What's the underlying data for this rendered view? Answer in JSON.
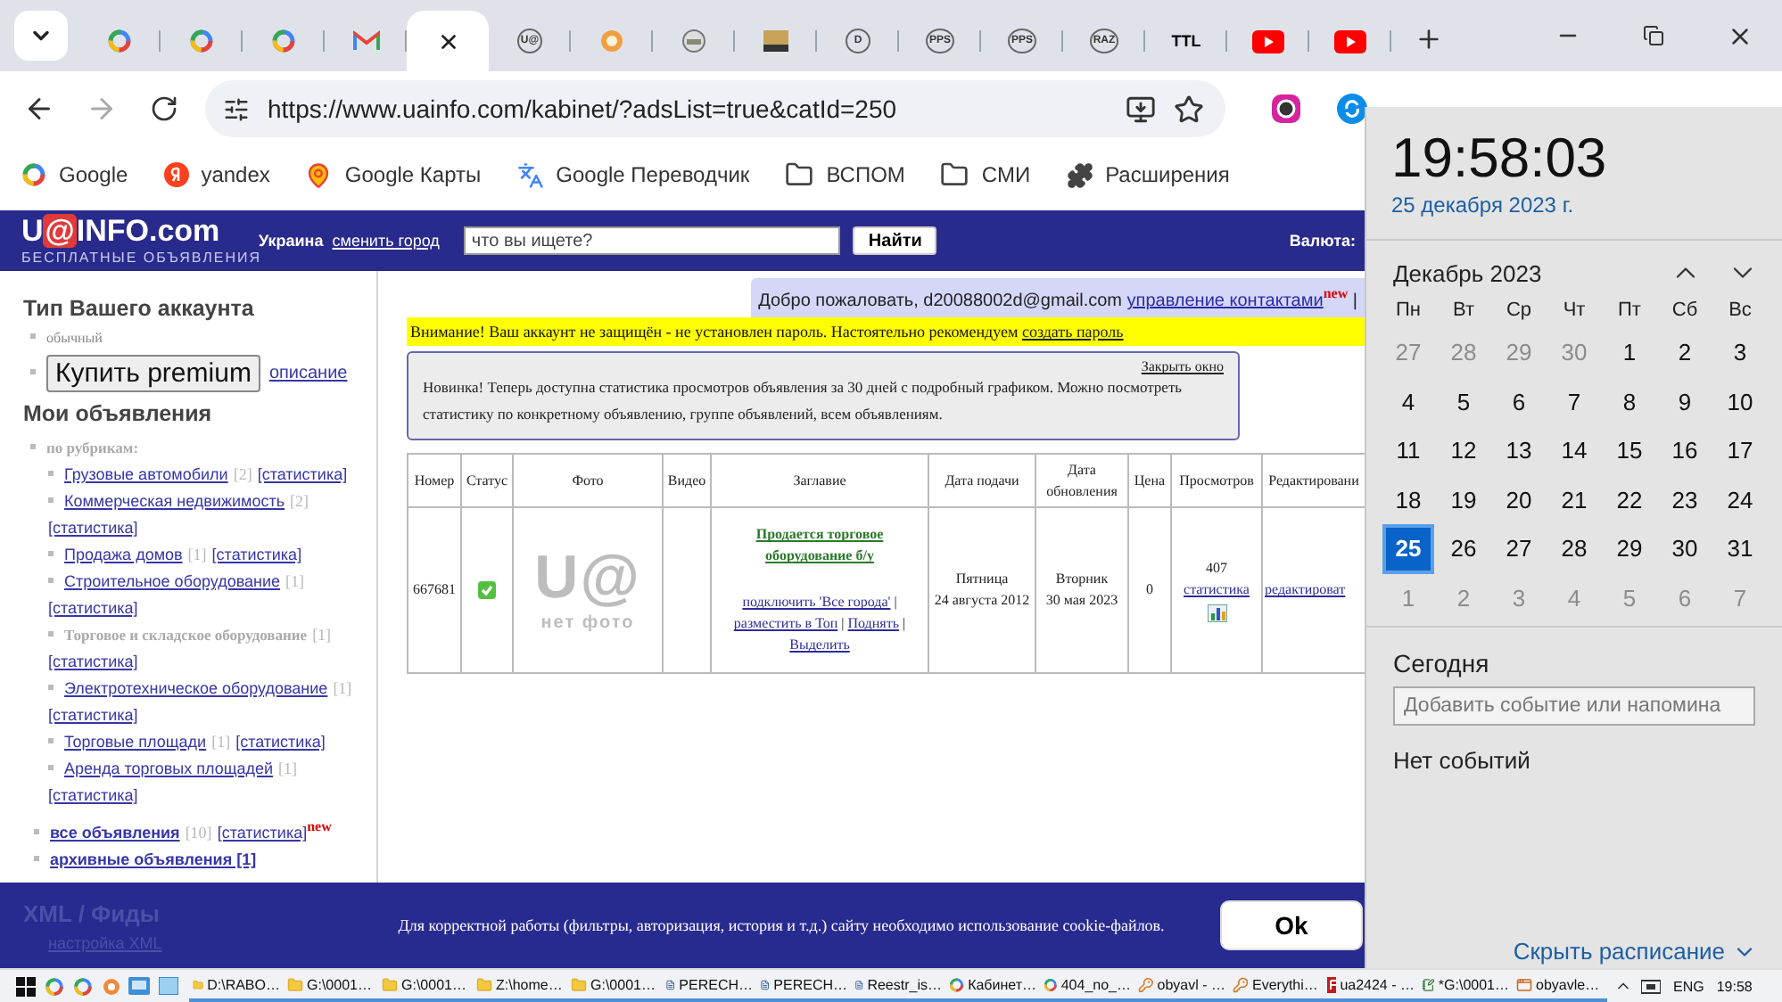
{
  "browser": {
    "tabs": [
      {
        "kind": "ring",
        "selected": false
      },
      {
        "kind": "ring",
        "selected": false
      },
      {
        "kind": "ring",
        "selected": false
      },
      {
        "kind": "mail",
        "selected": false
      },
      {
        "kind": "blank",
        "selected": true
      },
      {
        "kind": "text",
        "label": "U@",
        "selected": false
      },
      {
        "kind": "dot",
        "selected": false
      },
      {
        "kind": "roundphoto",
        "selected": false
      },
      {
        "kind": "photo",
        "selected": false
      },
      {
        "kind": "text",
        "label": "D",
        "selected": false
      },
      {
        "kind": "text",
        "label": "PPS",
        "selected": false
      },
      {
        "kind": "text",
        "label": "PPS",
        "selected": false
      },
      {
        "kind": "text",
        "label": "RAZ",
        "selected": false
      },
      {
        "kind": "boldtext",
        "label": "TTL",
        "selected": false
      },
      {
        "kind": "play",
        "selected": false
      },
      {
        "kind": "play",
        "selected": false
      }
    ],
    "url": "https://www.uainfo.com/kabinet/?adsList=true&catId=250",
    "bookmarks": [
      {
        "label": "Google",
        "kind": "ring"
      },
      {
        "label": "yandex",
        "kind": "dot"
      },
      {
        "label": "Google Карты",
        "kind": "pin"
      },
      {
        "label": "Google Переводчик",
        "kind": "translate"
      },
      {
        "label": "ВСПОМ",
        "kind": "folder"
      },
      {
        "label": "СМИ",
        "kind": "folder"
      },
      {
        "label": "Расширения",
        "kind": "puzzle"
      }
    ]
  },
  "site_header": {
    "logo": {
      "before": "U",
      "mark": "@",
      "after": "INFO.com"
    },
    "tagline": "БЕСПЛАТНЫЕ ОБЪЯВЛЕНИЯ",
    "region": "Украина",
    "change_city": "сменить город",
    "search": {
      "placeholder": "что вы ищете?"
    },
    "search_button": "Найти",
    "currency_label": "Валюта:"
  },
  "sidebar": {
    "account_heading": "Тип Вашего аккаунта",
    "account_type": "обычный",
    "premium_button": "Купить premium",
    "premium_link": "описание",
    "ads_heading": "Мои объявления",
    "by_category": "по рубрикам:",
    "categories": [
      {
        "name": "Грузовые автомобили",
        "linked": true,
        "count": "[2]",
        "stats": "[статистика]"
      },
      {
        "name": "Коммерческая недвижимость",
        "linked": true,
        "count": "[2]",
        "stats": "[статистика]"
      },
      {
        "name": "Продажа домов",
        "linked": true,
        "count": "[1]",
        "stats": "[статистика]"
      },
      {
        "name": "Строительное оборудование",
        "linked": true,
        "count": "[1]",
        "stats": "[статистика]"
      },
      {
        "name": "Торговое и складское оборудование",
        "linked": false,
        "count": "[1]",
        "stats": "[статистика]"
      },
      {
        "name": "Электротехническое оборудование",
        "linked": true,
        "count": "[1]",
        "stats": "[статистика]"
      },
      {
        "name": "Торговые площади",
        "linked": true,
        "count": "[1]",
        "stats": "[статистика]"
      },
      {
        "name": "Аренда торговых площадей",
        "linked": true,
        "count": "[1]",
        "stats": "[статистика]"
      }
    ],
    "all_ads": {
      "label": "все объявления",
      "count": "[10]",
      "stats": "[статистика]",
      "badge": "new"
    },
    "archive": "архивные объявления [1]",
    "xml_heading": "XML / Фиды",
    "xml_setting": "настройка XML"
  },
  "main": {
    "welcome": {
      "text": "Добро пожаловать, d20088002d@gmail.com",
      "link": "управление контактами",
      "badge": "new",
      "separator": "|"
    },
    "warning": {
      "text": "Внимание! Ваш аккаунт не защищён - не установлен пароль. Настоятельно рекомендуем",
      "link": "создать пароль"
    },
    "notice": {
      "close": "Закрыть окно",
      "text": "Новинка! Теперь доступна статистика просмотров объявления за 30 дней с подробный графиком. Можно посмотреть статистику по конкретному объявлению, группе объявлений, всем объявлениям."
    },
    "table": {
      "columns": [
        "Номер",
        "Статус",
        "Фото",
        "Видео",
        "Заглавие",
        "Дата подачи",
        "Дата обновления",
        "Цена",
        "Просмотров",
        "Редактировани"
      ],
      "rows": [
        {
          "number": "667681",
          "status_ok": true,
          "photo_logo": "U@",
          "photo_caption": "нет фото",
          "title": "Продается торговое оборудование б/у",
          "actions": [
            "подключить 'Все города'",
            "разместить в Топ",
            "Поднять",
            "Выделить"
          ],
          "action_separator": "|",
          "posted_day": "Пятница",
          "posted_date": "24 августа 2012",
          "updated_day": "Вторник",
          "updated_date": "30 мая 2023",
          "price": "0",
          "views": "407",
          "stats": "статистика",
          "edit": "редактироват"
        }
      ]
    },
    "cookie": {
      "text": "Для корректной работы (фильтры, авторизация, история и т.д.) сайту необходимо использование cookie-файлов.",
      "button": "Ok"
    }
  },
  "clock_panel": {
    "time": "19:58:03",
    "date": "25 декабря 2023 г.",
    "month": "Декабрь 2023",
    "weekdays": [
      "Пн",
      "Вт",
      "Ср",
      "Чт",
      "Пт",
      "Сб",
      "Вс"
    ],
    "days": [
      {
        "label": "27",
        "in_month": false,
        "selected": false
      },
      {
        "label": "28",
        "in_month": false,
        "selected": false
      },
      {
        "label": "29",
        "in_month": false,
        "selected": false
      },
      {
        "label": "30",
        "in_month": false,
        "selected": false
      },
      {
        "label": "1",
        "in_month": true,
        "selected": false
      },
      {
        "label": "2",
        "in_month": true,
        "selected": false
      },
      {
        "label": "3",
        "in_month": true,
        "selected": false
      },
      {
        "label": "4",
        "in_month": true,
        "selected": false
      },
      {
        "label": "5",
        "in_month": true,
        "selected": false
      },
      {
        "label": "6",
        "in_month": true,
        "selected": false
      },
      {
        "label": "7",
        "in_month": true,
        "selected": false
      },
      {
        "label": "8",
        "in_month": true,
        "selected": false
      },
      {
        "label": "9",
        "in_month": true,
        "selected": false
      },
      {
        "label": "10",
        "in_month": true,
        "selected": false
      },
      {
        "label": "11",
        "in_month": true,
        "selected": false
      },
      {
        "label": "12",
        "in_month": true,
        "selected": false
      },
      {
        "label": "13",
        "in_month": true,
        "selected": false
      },
      {
        "label": "14",
        "in_month": true,
        "selected": false
      },
      {
        "label": "15",
        "in_month": true,
        "selected": false
      },
      {
        "label": "16",
        "in_month": true,
        "selected": false
      },
      {
        "label": "17",
        "in_month": true,
        "selected": false
      },
      {
        "label": "18",
        "in_month": true,
        "selected": false
      },
      {
        "label": "19",
        "in_month": true,
        "selected": false
      },
      {
        "label": "20",
        "in_month": true,
        "selected": false
      },
      {
        "label": "21",
        "in_month": true,
        "selected": false
      },
      {
        "label": "22",
        "in_month": true,
        "selected": false
      },
      {
        "label": "23",
        "in_month": true,
        "selected": false
      },
      {
        "label": "24",
        "in_month": true,
        "selected": false
      },
      {
        "label": "25",
        "in_month": true,
        "selected": true
      },
      {
        "label": "26",
        "in_month": true,
        "selected": false
      },
      {
        "label": "27",
        "in_month": true,
        "selected": false
      },
      {
        "label": "28",
        "in_month": true,
        "selected": false
      },
      {
        "label": "29",
        "in_month": true,
        "selected": false
      },
      {
        "label": "30",
        "in_month": true,
        "selected": false
      },
      {
        "label": "31",
        "in_month": true,
        "selected": false
      },
      {
        "label": "1",
        "in_month": false,
        "selected": false
      },
      {
        "label": "2",
        "in_month": false,
        "selected": false
      },
      {
        "label": "3",
        "in_month": false,
        "selected": false
      },
      {
        "label": "4",
        "in_month": false,
        "selected": false
      },
      {
        "label": "5",
        "in_month": false,
        "selected": false
      },
      {
        "label": "6",
        "in_month": false,
        "selected": false
      },
      {
        "label": "7",
        "in_month": false,
        "selected": false
      }
    ],
    "today_heading": "Сегодня",
    "event_field": {
      "placeholder": "Добавить событие или напомина"
    },
    "no_events": "Нет событий",
    "hide_schedule": "Скрыть расписание"
  },
  "taskbar": {
    "windows": [
      {
        "label": "D:\\RABO…",
        "kind": "folder"
      },
      {
        "label": "G:\\0001…",
        "kind": "folder"
      },
      {
        "label": "G:\\0001…",
        "kind": "folder"
      },
      {
        "label": "Z:\\home…",
        "kind": "folder"
      },
      {
        "label": "G:\\0001…",
        "kind": "folder"
      },
      {
        "label": "PERECH…",
        "kind": "doc"
      },
      {
        "label": "PERECH…",
        "kind": "doc"
      },
      {
        "label": "Reestr_is…",
        "kind": "doc"
      },
      {
        "label": "Кабинет…",
        "kind": "ring"
      },
      {
        "label": "404_no_…",
        "kind": "ring"
      },
      {
        "label": "obyavl - …",
        "kind": "key"
      },
      {
        "label": "Everythi…",
        "kind": "key"
      },
      {
        "label": "ua2424 - …",
        "kind": "square"
      },
      {
        "label": "*G:\\0001…",
        "kind": "note"
      },
      {
        "label": "obyavle…",
        "kind": "app"
      }
    ],
    "language": "ENG",
    "time": "19:58"
  }
}
